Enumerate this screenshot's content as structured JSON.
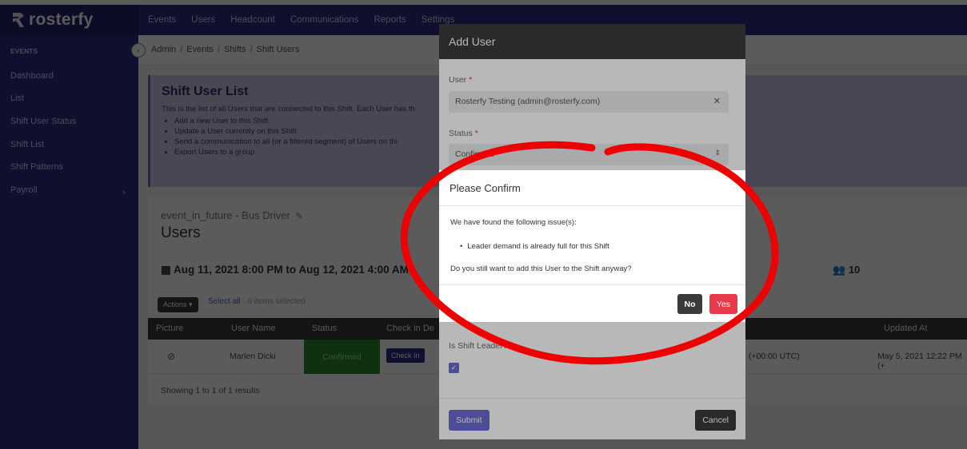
{
  "brand": {
    "name": "rosterfy"
  },
  "nav": {
    "items": [
      "Events",
      "Users",
      "Headcount",
      "Communications",
      "Reports",
      "Settings"
    ]
  },
  "sidebar": {
    "section_title": "EVENTS",
    "items": [
      "Dashboard",
      "List",
      "Shift User Status",
      "Shift List",
      "Shift Patterns",
      "Payroll"
    ]
  },
  "breadcrumb": [
    "Admin",
    "Events",
    "Shifts",
    "Shift Users"
  ],
  "hero": {
    "title": "Shift User List",
    "description": "This is the list of all Users that are connected to this Shift. Each User has th",
    "bullets": [
      "Add a new User to this Shift",
      "Update a User currently on this Shift",
      "Send a communication to all (or a filtered segment) of Users on thi",
      "Export Users to a group"
    ]
  },
  "event": {
    "subtitle": "event_in_future - Bus Driver",
    "title": "Users",
    "date_range": "Aug 11, 2021 8:00 PM to Aug 12, 2021 4:00 AM",
    "count": "10"
  },
  "table": {
    "actions_label": "Actions",
    "select_all": "Select all",
    "selected_text": "0 items selected",
    "headers": [
      "Picture",
      "User Name",
      "Status",
      "Check in De",
      "",
      "Updated At"
    ],
    "row": {
      "user_name": "Marlen Dicki",
      "status": "Confirmed",
      "checkin": "Check In",
      "time_fragment": "I (+00:00 UTC)",
      "updated_at": "May 5, 2021 12:22 PM (+"
    },
    "showing": "Showing 1 to 1 of 1 results"
  },
  "add_user_modal": {
    "title": "Add User",
    "user_label": "User",
    "user_value": "Rosterfy Testing (admin@rosterfy.com)",
    "status_label": "Status",
    "status_value": "Confirmed",
    "leader_label": "Is Shift Leader?",
    "submit": "Submit",
    "cancel": "Cancel"
  },
  "confirm_modal": {
    "title": "Please Confirm",
    "intro": "We have found the following issue(s):",
    "issue": "Leader demand is already full for this Shift",
    "question": "Do you still want to add this User to the Shift anyway?",
    "no": "No",
    "yes": "Yes"
  },
  "colors": {
    "primary": "#2c2b80",
    "accent": "#6a6bd0",
    "danger": "#e83a4b",
    "success": "#2e8b2e",
    "annotation": "#ee0000"
  }
}
